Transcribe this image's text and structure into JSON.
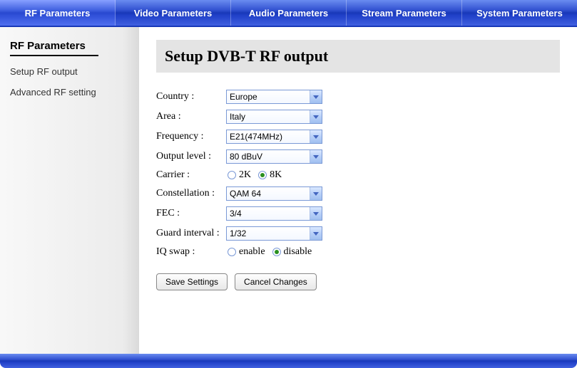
{
  "topnav": {
    "items": [
      {
        "label": "RF Parameters",
        "active": true
      },
      {
        "label": "Video Parameters",
        "active": false
      },
      {
        "label": "Audio Parameters",
        "active": false
      },
      {
        "label": "Stream Parameters",
        "active": false
      },
      {
        "label": "System Parameters",
        "active": false
      }
    ]
  },
  "sidebar": {
    "title": "RF Parameters",
    "links": [
      {
        "label": "Setup RF output"
      },
      {
        "label": "Advanced RF setting"
      }
    ]
  },
  "page": {
    "title": "Setup DVB-T RF output"
  },
  "form": {
    "country": {
      "label": "Country :",
      "value": "Europe"
    },
    "area": {
      "label": "Area :",
      "value": "Italy"
    },
    "frequency": {
      "label": "Frequency :",
      "value": "E21(474MHz)"
    },
    "output_level": {
      "label": "Output level :",
      "value": "80 dBuV"
    },
    "carrier": {
      "label": "Carrier :",
      "options": [
        {
          "label": "2K",
          "checked": false
        },
        {
          "label": "8K",
          "checked": true
        }
      ]
    },
    "constellation": {
      "label": "Constellation :",
      "value": "QAM 64"
    },
    "fec": {
      "label": "FEC :",
      "value": "3/4"
    },
    "guard_interval": {
      "label": "Guard interval :",
      "value": "1/32"
    },
    "iq_swap": {
      "label": "IQ swap :",
      "options": [
        {
          "label": "enable",
          "checked": false
        },
        {
          "label": "disable",
          "checked": true
        }
      ]
    }
  },
  "buttons": {
    "save": "Save Settings",
    "cancel": "Cancel Changes"
  }
}
